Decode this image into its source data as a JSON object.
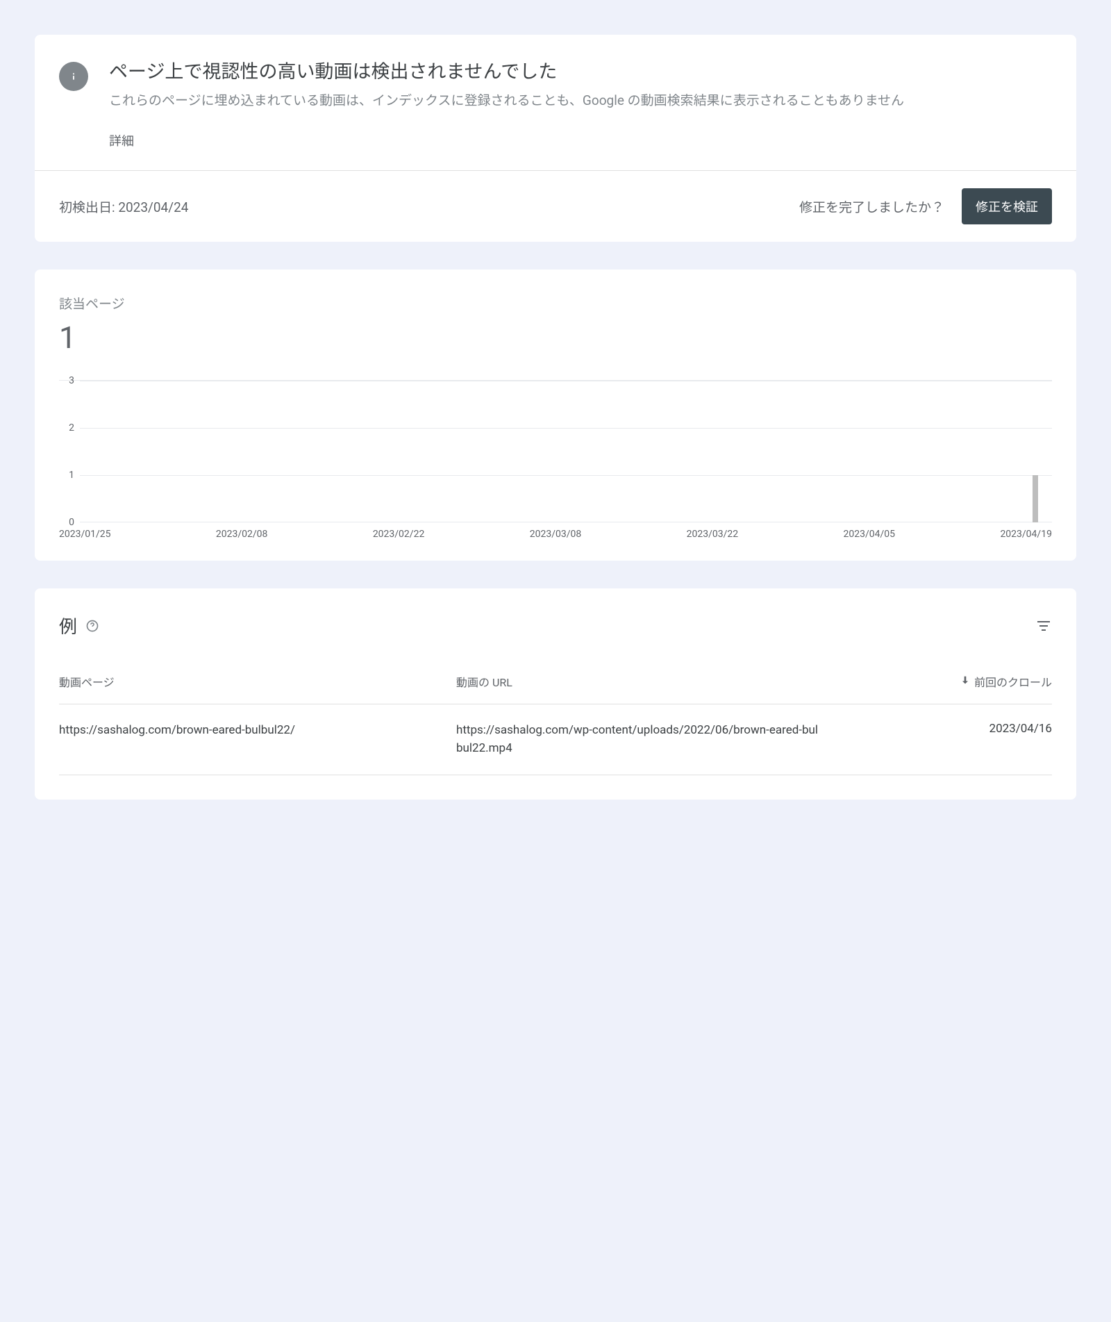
{
  "header": {
    "title": "ページ上で視認性の高い動画は検出されませんでした",
    "subtitle": "これらのページに埋め込まれている動画は、インデックスに登録されることも、Google の動画検索結果に表示されることもありません",
    "learn_more": "詳細"
  },
  "detection": {
    "first_detected_label": "初検出日:",
    "first_detected_date": "2023/04/24",
    "fix_question": "修正を完了しましたか？",
    "validate_button": "修正を検証"
  },
  "chart": {
    "title": "該当ページ",
    "value": "1"
  },
  "chart_data": {
    "type": "bar",
    "categories": [
      "2023/01/25",
      "2023/02/08",
      "2023/02/22",
      "2023/03/08",
      "2023/03/22",
      "2023/04/05",
      "2023/04/19"
    ],
    "values": [
      0,
      0,
      0,
      0,
      0,
      0,
      1
    ],
    "title": "該当ページ",
    "ylabel": "",
    "xlabel": "",
    "yticks": [
      0,
      1,
      2,
      3
    ],
    "ylim": [
      0,
      3
    ]
  },
  "examples": {
    "title": "例",
    "columns": {
      "page": "動画ページ",
      "url": "動画の URL",
      "crawl": "前回のクロール"
    },
    "rows": [
      {
        "page": "https://sashalog.com/brown-eared-bulbul22/",
        "url": "https://sashalog.com/wp-content/uploads/2022/06/brown-eared-bulbul22.mp4",
        "crawl": "2023/04/16"
      }
    ]
  }
}
